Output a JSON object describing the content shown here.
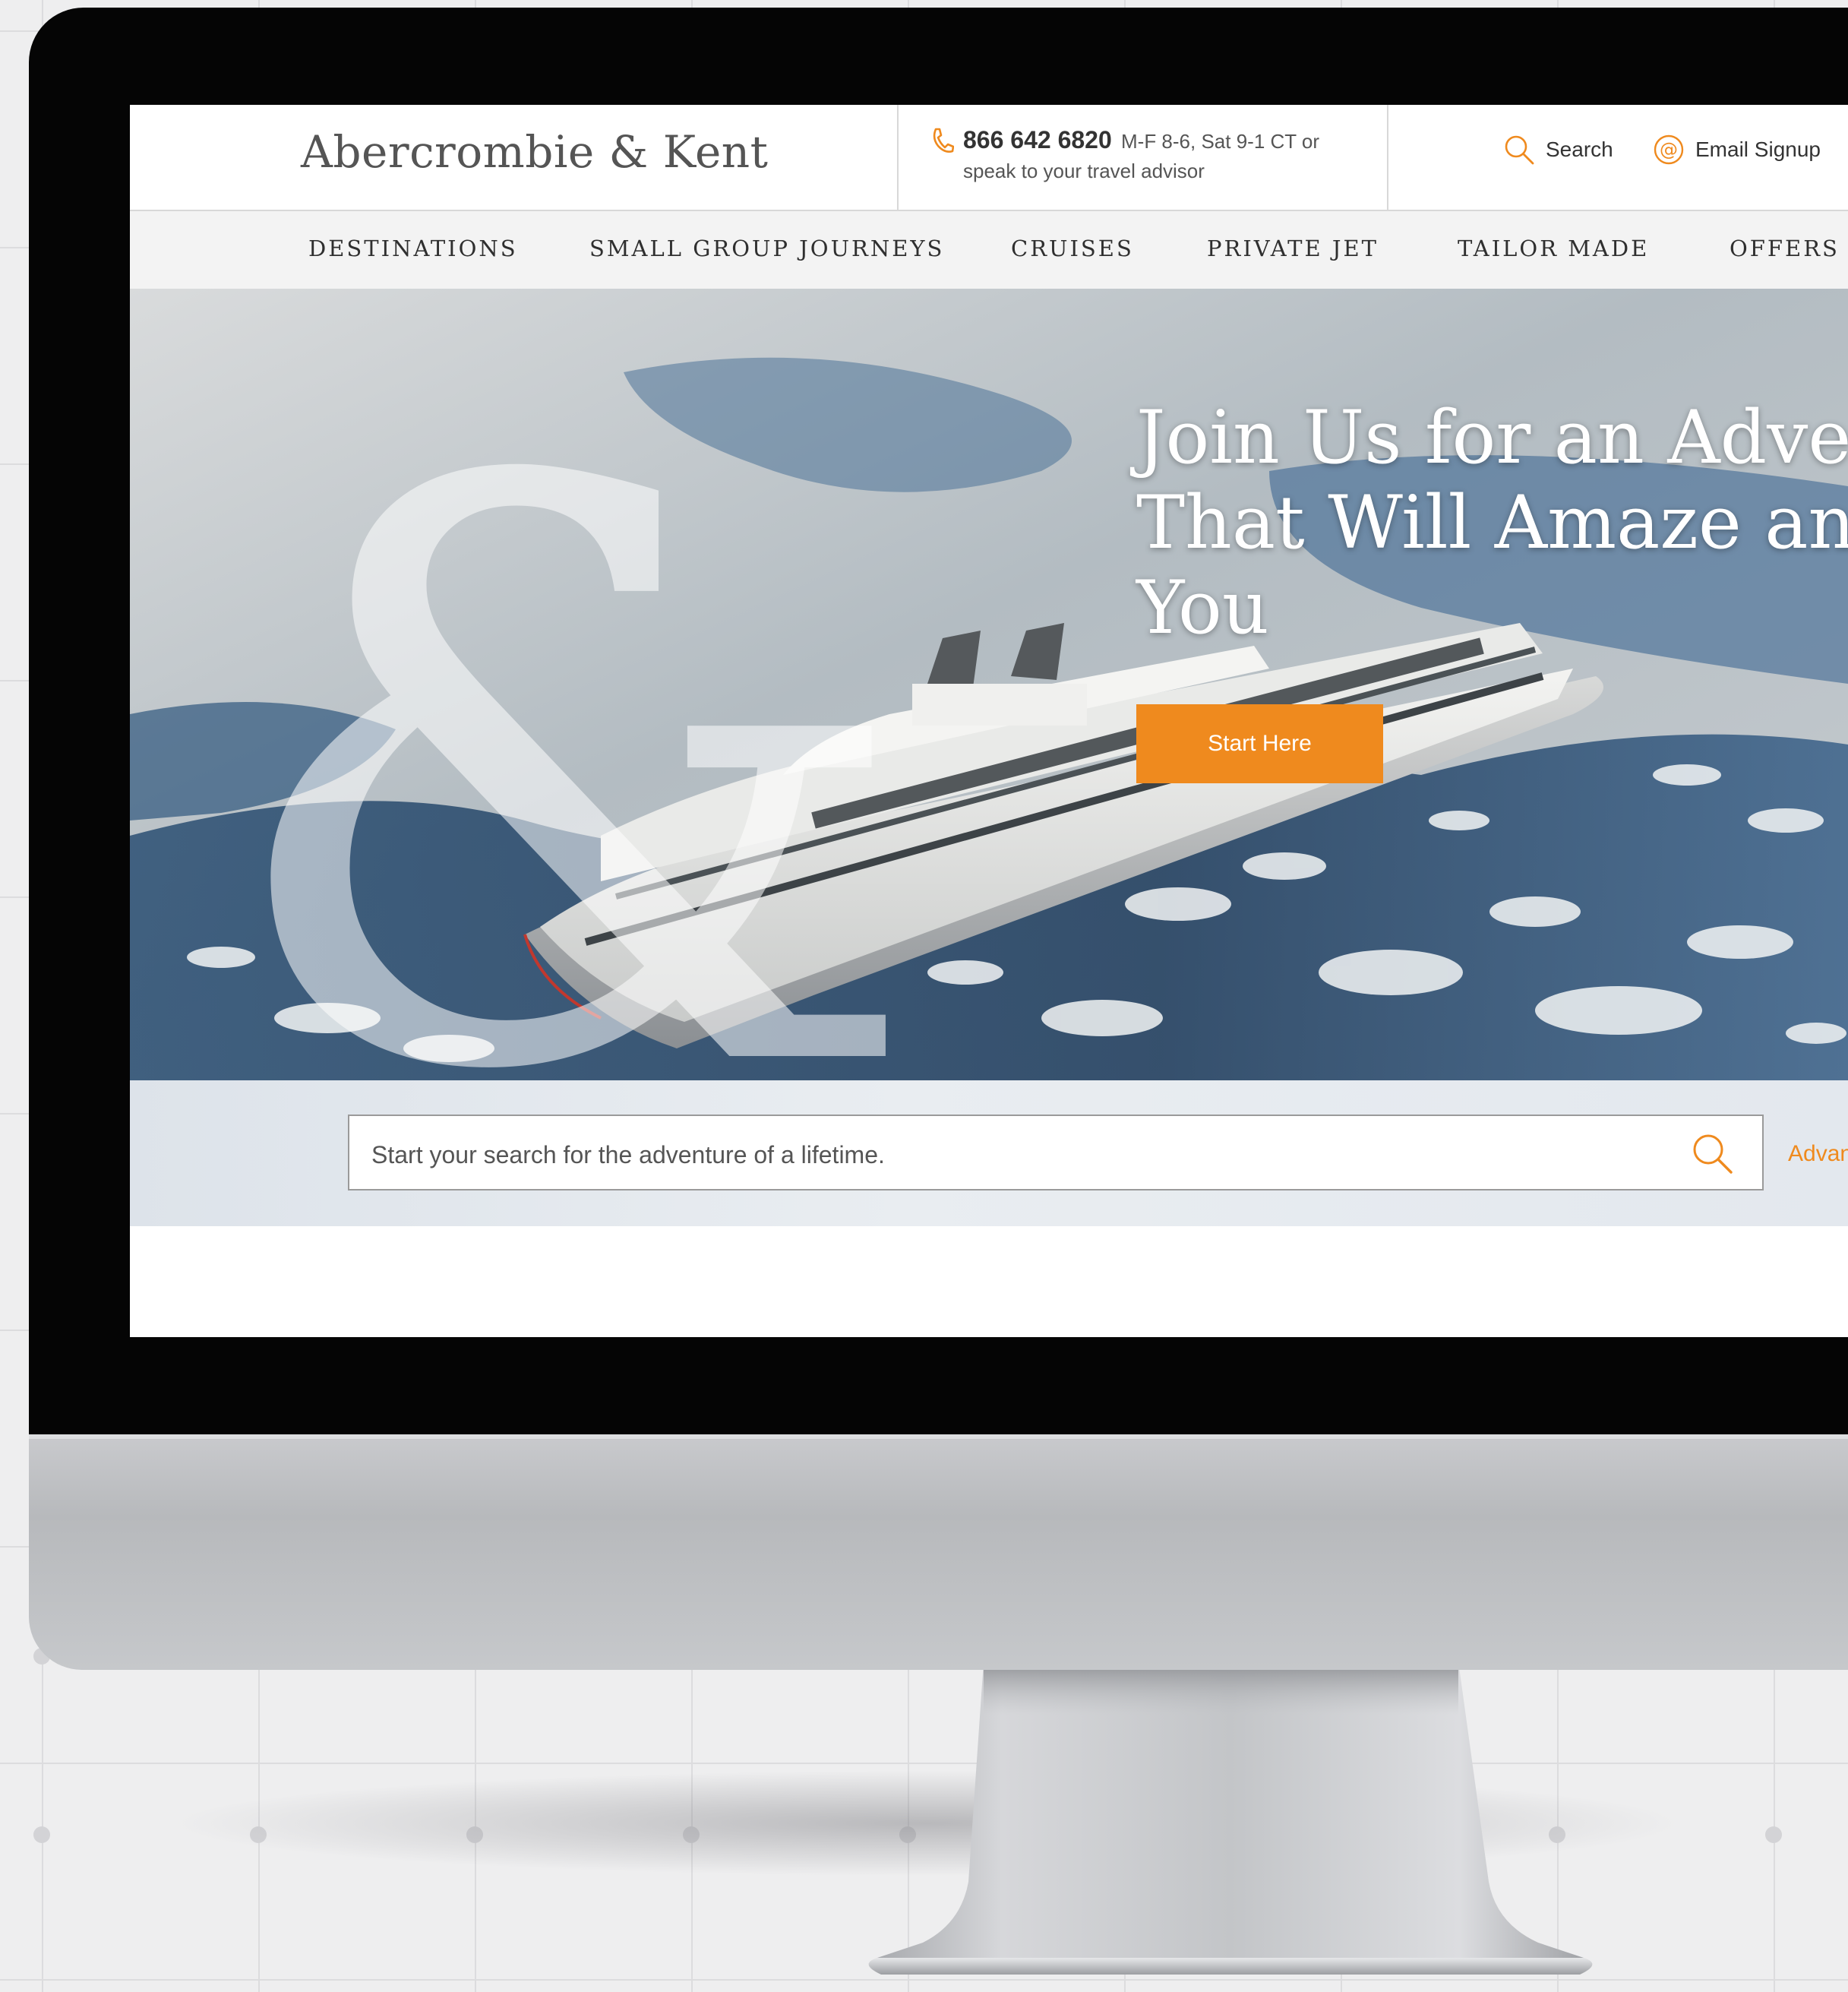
{
  "brand": {
    "name": "Abercrombie & Kent",
    "accent_color": "#ef8a1e"
  },
  "header": {
    "phone_number": "866 642 6820",
    "phone_hours": "M-F 8-6, Sat 9-1 CT or",
    "phone_advisor": "speak to your travel advisor",
    "search_label": "Search",
    "email_label": "Email Signup",
    "icons": {
      "phone": "phone-icon",
      "search": "search-icon",
      "email": "at-sign-icon"
    }
  },
  "nav": {
    "items": [
      {
        "label": "DESTINATIONS"
      },
      {
        "label": "SMALL GROUP JOURNEYS"
      },
      {
        "label": "CRUISES"
      },
      {
        "label": "PRIVATE JET"
      },
      {
        "label": "TAILOR MADE"
      },
      {
        "label": "OFFERS"
      }
    ]
  },
  "hero": {
    "headline_line1": "Join Us for an Adventure",
    "headline_line2": "That Will Amaze and Inspire",
    "headline_line3": "You",
    "cta_label": "Start Here",
    "watermark": "&"
  },
  "search": {
    "placeholder": "Start your search for the adventure of a lifetime.",
    "advanced_label": "Advanced"
  }
}
